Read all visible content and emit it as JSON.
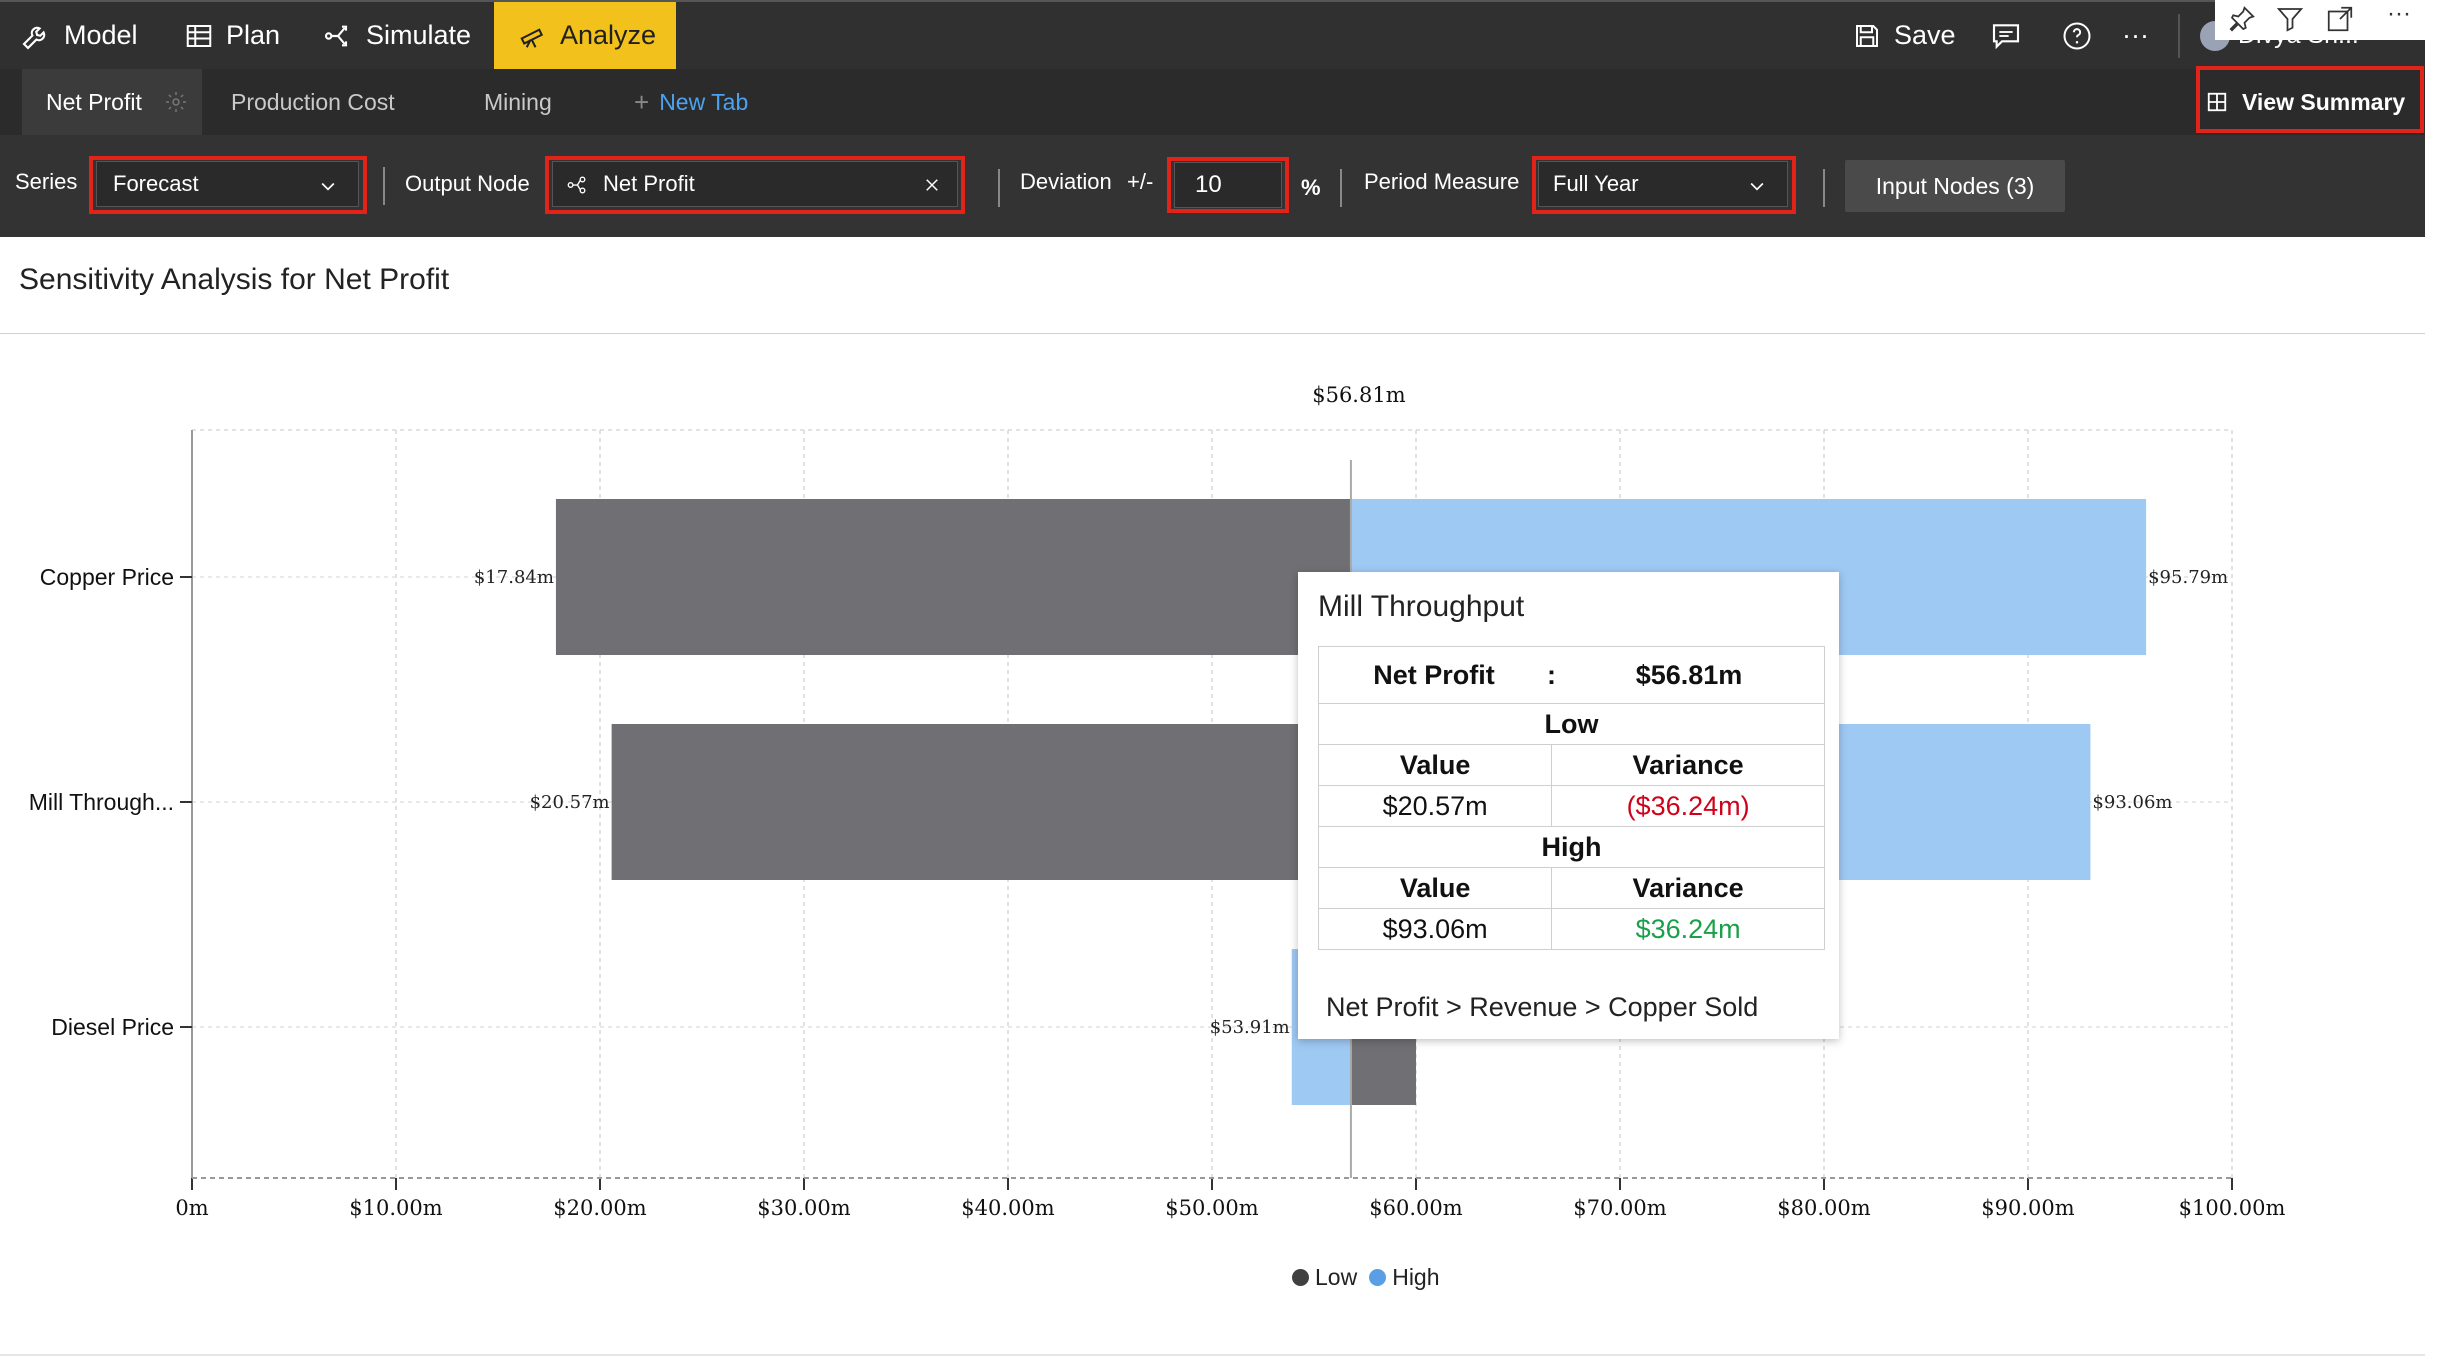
{
  "nav": {
    "model": "Model",
    "plan": "Plan",
    "simulate": "Simulate",
    "analyze": "Analyze",
    "save": "Save",
    "more": "···",
    "user": "Divya Sh..."
  },
  "tabs": {
    "net_profit": "Net Profit",
    "production_cost": "Production Cost",
    "mining": "Mining",
    "new_tab": "New Tab",
    "view_summary": "View Summary"
  },
  "toolbar": {
    "series_label": "Series",
    "series_value": "Forecast",
    "output_node_label": "Output Node",
    "output_node_value": "Net Profit",
    "deviation_label": "Deviation",
    "plus_minus": "+/-",
    "deviation_value": "10",
    "percent": "%",
    "period_measure_label": "Period Measure",
    "period_measure_value": "Full Year",
    "input_nodes_button": "Input Nodes (3)"
  },
  "page": {
    "title": "Sensitivity Analysis for Net Profit"
  },
  "chart_data": {
    "type": "bar",
    "orientation": "horizontal-tornado",
    "baseline": 56.81,
    "baseline_label": "$56.81m",
    "categories": [
      "Copper Price",
      "Mill Through...",
      "Diesel Price"
    ],
    "series": [
      {
        "name": "Low",
        "values": [
          17.84,
          20.57,
          60.0
        ],
        "labels": [
          "$17.84m",
          "$20.57m",
          ""
        ],
        "color": "#707074"
      },
      {
        "name": "High",
        "values": [
          95.79,
          93.06,
          53.91
        ],
        "labels": [
          "$95.79m",
          "$93.06m",
          "$53.91m"
        ],
        "color": "#9ec9f3"
      }
    ],
    "xlim": [
      0,
      100
    ],
    "xticks": [
      "0m",
      "$10.00m",
      "$20.00m",
      "$30.00m",
      "$40.00m",
      "$50.00m",
      "$60.00m",
      "$70.00m",
      "$80.00m",
      "$90.00m",
      "$100.00m"
    ],
    "grid": true,
    "legend": [
      "Low",
      "High"
    ],
    "legend_placement": "bottom-center"
  },
  "tooltip": {
    "title": "Mill Throughput",
    "net_profit_label": "Net Profit",
    "colon": ":",
    "net_profit_value": "$56.81m",
    "low_label": "Low",
    "high_label": "High",
    "value_header": "Value",
    "variance_header": "Variance",
    "low_value": "$20.57m",
    "low_variance": "($36.24m)",
    "high_value": "$93.06m",
    "high_variance": "$36.24m",
    "path": "Net Profit > Revenue > Copper Sold"
  },
  "colors": {
    "accent": "#f2c11c",
    "highlight_border": "#e2231a",
    "low_bar": "#707074",
    "high_bar": "#9ec9f3",
    "new_tab": "#4aa3f0"
  }
}
